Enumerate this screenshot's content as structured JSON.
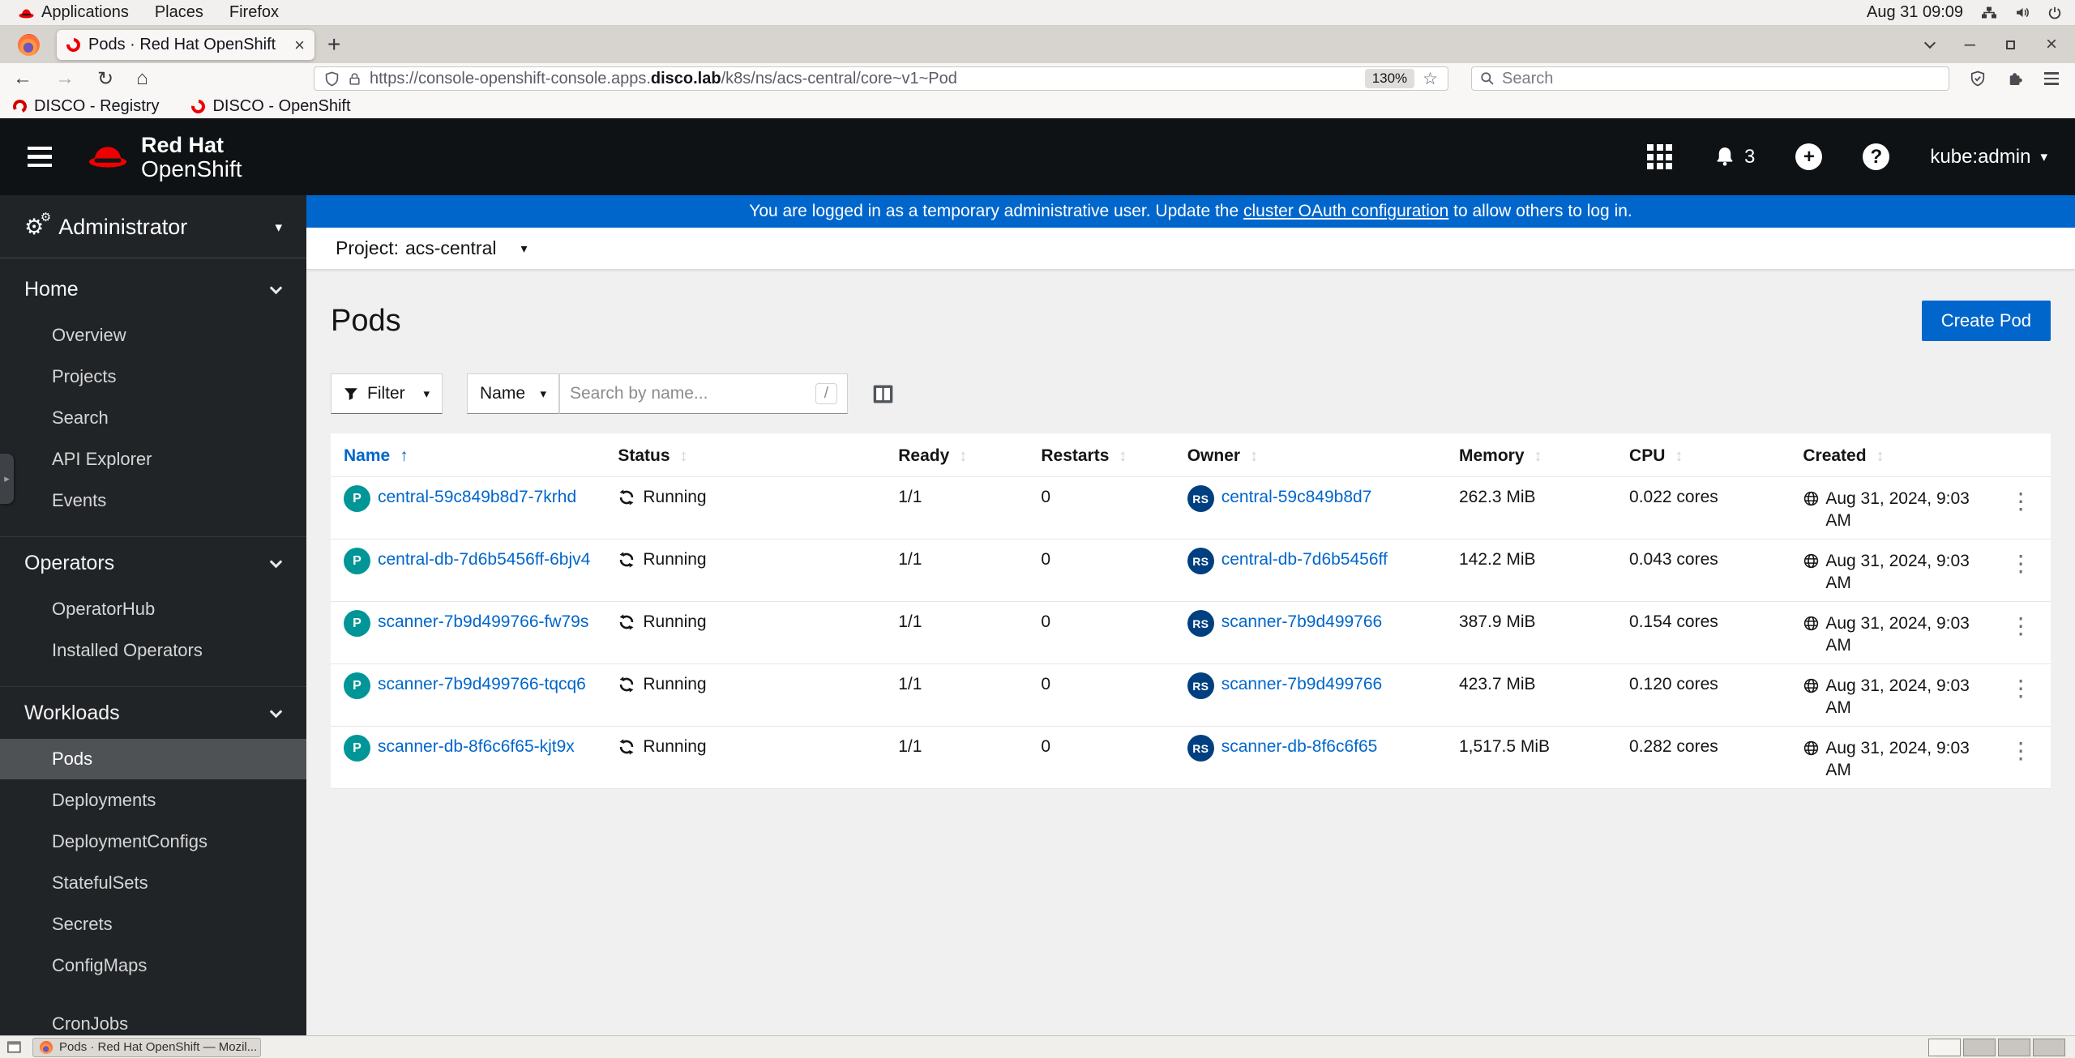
{
  "desktop": {
    "menus": {
      "applications": "Applications",
      "places": "Places",
      "firefox": "Firefox"
    },
    "clock": "Aug 31 09:09"
  },
  "browser": {
    "tab": {
      "title": "Pods · Red Hat OpenShift"
    },
    "nav": {
      "url_prefix": "https://console-openshift-console.apps.",
      "url_domain": "disco.lab",
      "url_path": "/k8s/ns/acs-central/core~v1~Pod",
      "zoom_level": "130%",
      "search_placeholder": "Search"
    },
    "bookmarks": [
      {
        "label": "DISCO - Registry"
      },
      {
        "label": "DISCO - OpenShift"
      }
    ]
  },
  "icons": {
    "back": "←",
    "forward": "→",
    "reload": "↻",
    "home": "⌂",
    "star": "☆",
    "tab_close": "×",
    "new_tab": "+",
    "window_minimize": "–",
    "window_close": "×",
    "caret_down": "▾",
    "kebab": "⋮",
    "sort_asc": "↑",
    "sort_inactive": "↕",
    "gear": "⚙",
    "drawer_arrow": "▸"
  },
  "console": {
    "masthead": {
      "brand_top": "Red Hat",
      "brand_bottom": "OpenShift",
      "notification_count": "3",
      "plus": "+",
      "help": "?",
      "user": "kube:admin"
    },
    "banner": {
      "before": "You are logged in as a temporary administrative user. Update the ",
      "link": "cluster OAuth configuration",
      "after": " to allow others to log in."
    },
    "project_bar": {
      "label": "Project:",
      "value": "acs-central"
    },
    "sidebar": {
      "perspective": "Administrator",
      "sections": [
        {
          "label": "Home",
          "items": [
            "Overview",
            "Projects",
            "Search",
            "API Explorer",
            "Events"
          ]
        },
        {
          "label": "Operators",
          "items": [
            "OperatorHub",
            "Installed Operators"
          ]
        },
        {
          "label": "Workloads",
          "items": [
            "Pods",
            "Deployments",
            "DeploymentConfigs",
            "StatefulSets",
            "Secrets",
            "ConfigMaps",
            "CronJobs"
          ],
          "active_item": "Pods"
        }
      ]
    },
    "page": {
      "title": "Pods",
      "create_button": "Create Pod"
    },
    "toolbar": {
      "filter_label": "Filter",
      "name_label": "Name",
      "search_placeholder": "Search by name...",
      "shortcut": "/"
    },
    "table": {
      "headers": [
        "Name",
        "Status",
        "Ready",
        "Restarts",
        "Owner",
        "Memory",
        "CPU",
        "Created"
      ],
      "pod_badge": "P",
      "owner_badge": "RS",
      "rows": [
        {
          "name": "central-59c849b8d7-7krhd",
          "status": "Running",
          "ready": "1/1",
          "restarts": "0",
          "owner": "central-59c849b8d7",
          "memory": "262.3 MiB",
          "cpu": "0.022 cores",
          "created": "Aug 31, 2024, 9:03 AM"
        },
        {
          "name": "central-db-7d6b5456ff-6bjv4",
          "status": "Running",
          "ready": "1/1",
          "restarts": "0",
          "owner": "central-db-7d6b5456ff",
          "memory": "142.2 MiB",
          "cpu": "0.043 cores",
          "created": "Aug 31, 2024, 9:03 AM"
        },
        {
          "name": "scanner-7b9d499766-fw79s",
          "status": "Running",
          "ready": "1/1",
          "restarts": "0",
          "owner": "scanner-7b9d499766",
          "memory": "387.9 MiB",
          "cpu": "0.154 cores",
          "created": "Aug 31, 2024, 9:03 AM"
        },
        {
          "name": "scanner-7b9d499766-tqcq6",
          "status": "Running",
          "ready": "1/1",
          "restarts": "0",
          "owner": "scanner-7b9d499766",
          "memory": "423.7 MiB",
          "cpu": "0.120 cores",
          "created": "Aug 31, 2024, 9:03 AM"
        },
        {
          "name": "scanner-db-8f6c6f65-kjt9x",
          "status": "Running",
          "ready": "1/1",
          "restarts": "0",
          "owner": "scanner-db-8f6c6f65",
          "memory": "1,517.5 MiB",
          "cpu": "0.282 cores",
          "created": "Aug 31, 2024, 9:03 AM"
        }
      ]
    },
    "colors": {
      "accent": "#0066cc",
      "brand_red": "#ee0000",
      "masthead_bg": "#0e1214",
      "sidebar_bg": "#212427",
      "sidebar_active_bg": "#4f5255",
      "pod_badge": "#009596",
      "owner_badge": "#004080",
      "content_bg": "#f0f0f0",
      "link": "#0066cc"
    }
  },
  "taskbar": {
    "window_title": "Pods · Red Hat OpenShift — Mozil...",
    "workspace_count": 4
  }
}
